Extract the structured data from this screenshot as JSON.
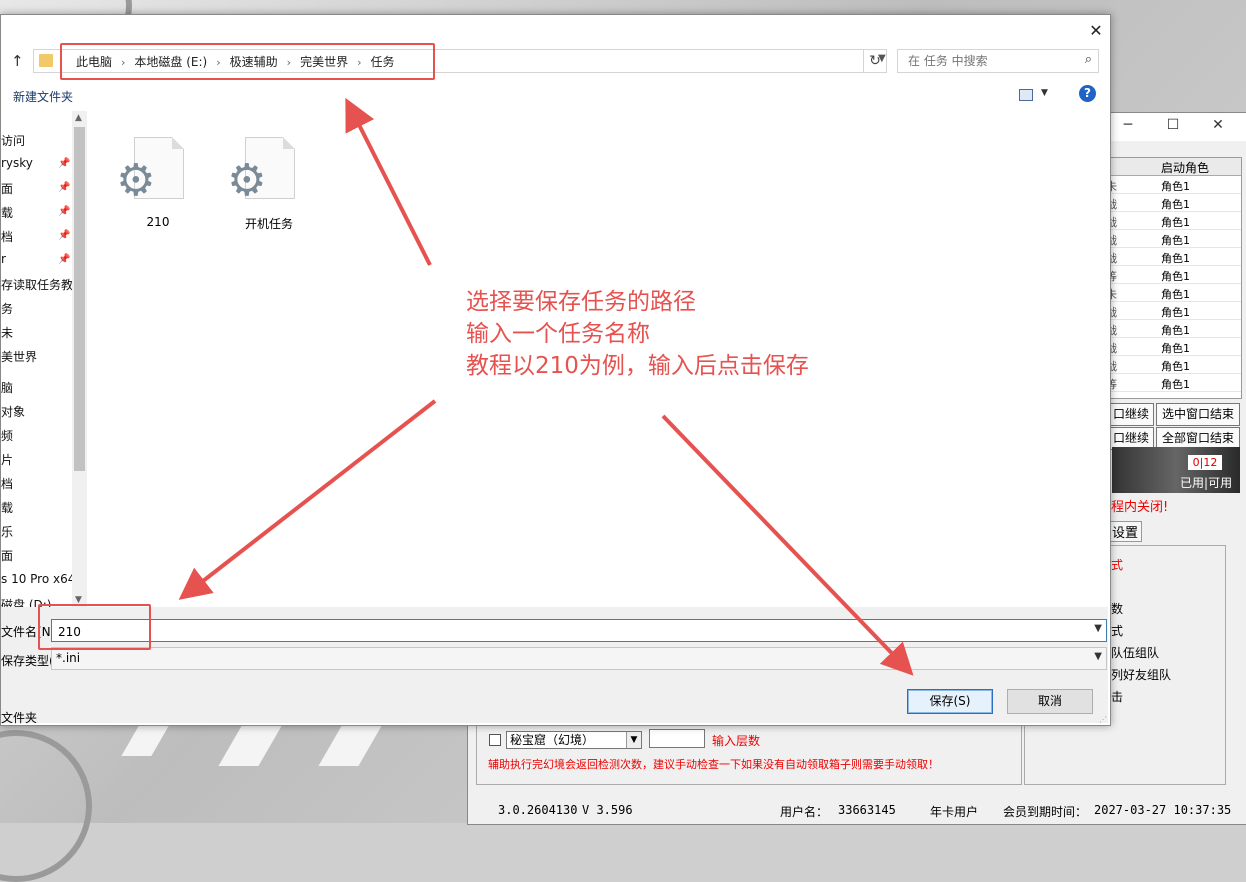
{
  "dialog": {
    "address_crumbs": [
      "此电脑",
      "本地磁盘 (E:)",
      "极速辅助",
      "完美世界",
      "任务"
    ],
    "search_placeholder": "在 任务 中搜索",
    "new_folder_label": "新建文件夹",
    "nav_items": [
      {
        "label": "访问",
        "pinned": false
      },
      {
        "label": "rysky",
        "pinned": true
      },
      {
        "label": "面",
        "pinned": true
      },
      {
        "label": "载",
        "pinned": true
      },
      {
        "label": "档",
        "pinned": true
      },
      {
        "label": "r",
        "pinned": true
      },
      {
        "label": "存读取任务教程",
        "pinned": false
      },
      {
        "label": "务",
        "pinned": false
      },
      {
        "label": "未",
        "pinned": false
      },
      {
        "label": "美世界",
        "pinned": false
      },
      {
        "label": "脑",
        "pinned": false
      },
      {
        "label": "对象",
        "pinned": false
      },
      {
        "label": "频",
        "pinned": false
      },
      {
        "label": "片",
        "pinned": false
      },
      {
        "label": "档",
        "pinned": false
      },
      {
        "label": "载",
        "pinned": false
      },
      {
        "label": "乐",
        "pinned": false
      },
      {
        "label": "面",
        "pinned": false
      },
      {
        "label": "s 10 Pro x64",
        "pinned": false
      },
      {
        "label": "磁盘 (D:)",
        "pinned": false
      }
    ],
    "files": [
      {
        "name": "210",
        "icon": "settings-file-icon"
      },
      {
        "name": "开机任务",
        "icon": "settings-file-icon"
      }
    ],
    "filename_label": "文件名(N):",
    "filename_value": "210",
    "filetype_label": "保存类型(T):",
    "filetype_value": "*.ini",
    "hide_folders_label": "文件夹",
    "save_label": "保存(S)",
    "cancel_label": "取消"
  },
  "annotation": {
    "lines": [
      "选择要保存任务的路径",
      "输入一个任务名称",
      "教程以210为例，输入后点击保存"
    ],
    "color": "#e6524f"
  },
  "background_app": {
    "table_header": "启动角色",
    "rows": [
      {
        "c1": "未",
        "c2": "角色1"
      },
      {
        "c1": "战",
        "c2": "角色1"
      },
      {
        "c1": "战",
        "c2": "角色1"
      },
      {
        "c1": "战",
        "c2": "角色1"
      },
      {
        "c1": "战",
        "c2": "角色1"
      },
      {
        "c1": "等",
        "c2": "角色1"
      },
      {
        "c1": "未",
        "c2": "角色1"
      },
      {
        "c1": "战",
        "c2": "角色1"
      },
      {
        "c1": "战",
        "c2": "角色1"
      },
      {
        "c1": "战",
        "c2": "角色1"
      },
      {
        "c1": "战",
        "c2": "角色1"
      },
      {
        "c1": "等",
        "c2": "角色1"
      }
    ],
    "continue_selected": "口继续",
    "end_selected": "选中窗口结束",
    "continue_all": "口继续",
    "end_all": "全部窗口结束",
    "count_used": "0",
    "count_avail": "12",
    "used_label": "已用",
    "avail_label": "可用",
    "red_notice": "程内关闭!",
    "tab_label": "设置",
    "side_labels": [
      "式",
      "数",
      "式",
      "队伍组队",
      "列好友组队",
      "击"
    ],
    "dungeon_select": "秘宝窟（幻境）",
    "floor_label": "输入层数",
    "hint": "辅助执行完幻境会返回检测次数，建议手动检查一下如果没有自动领取箱子则需要手动领取！",
    "status": {
      "version": "3.0.2604130",
      "v": "V 3.596",
      "user_label": "用户名：",
      "user": "33663145",
      "card": "年卡用户",
      "expire_label": "会员到期时间：",
      "expire": "2027-03-27 10:37:35"
    }
  }
}
